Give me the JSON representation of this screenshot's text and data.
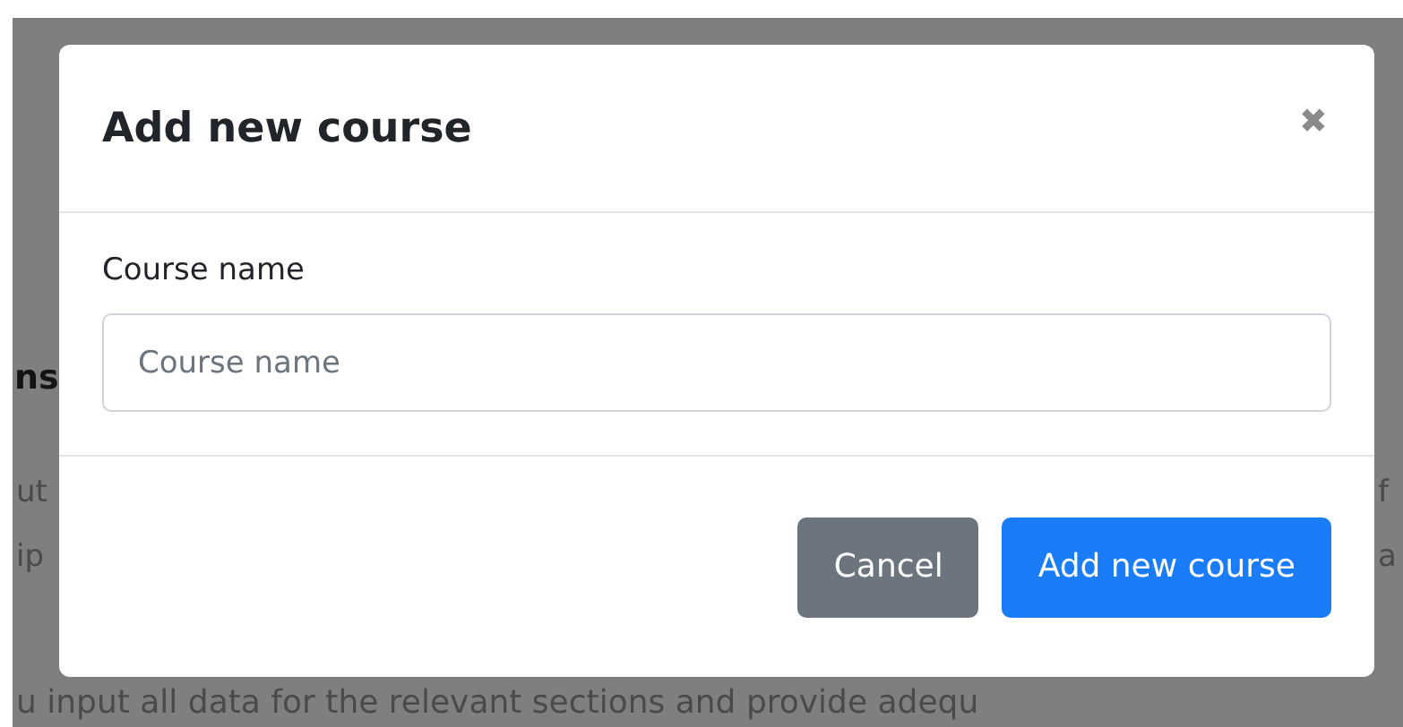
{
  "background": {
    "heading_fragment": "ns",
    "left_fragments": [
      "ut",
      "ip"
    ],
    "right_fragments": [
      "f",
      "a"
    ],
    "bottom_line": "u input all data for the relevant sections and provide adequ"
  },
  "modal": {
    "title": "Add new course",
    "close": "✖",
    "field_label": "Course name",
    "field": {
      "placeholder": "Course name"
    },
    "buttons": [
      {
        "label": "Cancel",
        "kind": "secondary"
      },
      {
        "label": "Add new course",
        "kind": "primary"
      }
    ]
  }
}
